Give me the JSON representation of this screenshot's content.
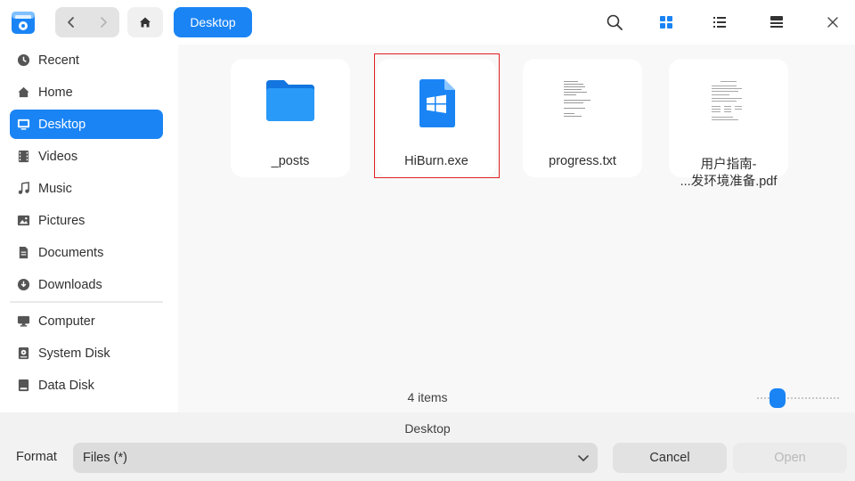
{
  "titlebar": {
    "breadcrumb": "Desktop",
    "icons": [
      "app-file-manager-icon",
      "back-icon",
      "forward-icon",
      "home-icon",
      "search-icon",
      "icon-view-icon",
      "list-view-icon",
      "detail-view-icon",
      "close-icon"
    ]
  },
  "sidebar": {
    "items": [
      {
        "label": "Recent",
        "icon": "clock-icon"
      },
      {
        "label": "Home",
        "icon": "home-icon"
      },
      {
        "label": "Desktop",
        "icon": "desktop-icon",
        "active": true
      },
      {
        "label": "Videos",
        "icon": "film-icon"
      },
      {
        "label": "Music",
        "icon": "music-note-icon"
      },
      {
        "label": "Pictures",
        "icon": "image-icon"
      },
      {
        "label": "Documents",
        "icon": "document-icon"
      },
      {
        "label": "Downloads",
        "icon": "download-icon"
      },
      {
        "label": "Computer",
        "icon": "monitor-icon"
      },
      {
        "label": "System Disk",
        "icon": "disk-icon"
      },
      {
        "label": "Data Disk",
        "icon": "disk-icon"
      }
    ]
  },
  "files": [
    {
      "name": "_posts",
      "type": "folder"
    },
    {
      "name": "HiBurn.exe",
      "type": "exe",
      "selected": true
    },
    {
      "name": "progress.txt",
      "type": "text"
    },
    {
      "name_line1": "用户指南-",
      "name_line2": "...发环境准备.pdf",
      "type": "pdf"
    }
  ],
  "status": {
    "item_count": "4 items"
  },
  "footer": {
    "path": "Desktop",
    "format_label": "Format",
    "format_value": "Files (*)",
    "cancel_label": "Cancel",
    "open_label": "Open"
  },
  "colors": {
    "accent": "#1a84f5",
    "selection_outline": "#e02020"
  }
}
